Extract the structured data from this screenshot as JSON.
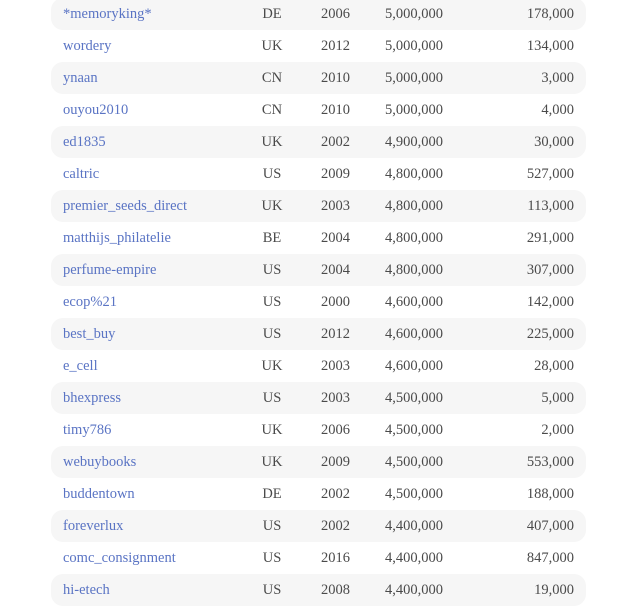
{
  "rows": [
    {
      "seller": "*memoryking*",
      "country": "DE",
      "year": "2006",
      "listings": "5,000,000",
      "feedback": "178,000"
    },
    {
      "seller": "wordery",
      "country": "UK",
      "year": "2012",
      "listings": "5,000,000",
      "feedback": "134,000"
    },
    {
      "seller": "ynaan",
      "country": "CN",
      "year": "2010",
      "listings": "5,000,000",
      "feedback": "3,000"
    },
    {
      "seller": "ouyou2010",
      "country": "CN",
      "year": "2010",
      "listings": "5,000,000",
      "feedback": "4,000"
    },
    {
      "seller": "ed1835",
      "country": "UK",
      "year": "2002",
      "listings": "4,900,000",
      "feedback": "30,000"
    },
    {
      "seller": "caltric",
      "country": "US",
      "year": "2009",
      "listings": "4,800,000",
      "feedback": "527,000"
    },
    {
      "seller": "premier_seeds_direct",
      "country": "UK",
      "year": "2003",
      "listings": "4,800,000",
      "feedback": "113,000"
    },
    {
      "seller": "matthijs_philatelie",
      "country": "BE",
      "year": "2004",
      "listings": "4,800,000",
      "feedback": "291,000"
    },
    {
      "seller": "perfume-empire",
      "country": "US",
      "year": "2004",
      "listings": "4,800,000",
      "feedback": "307,000"
    },
    {
      "seller": "ecop%21",
      "country": "US",
      "year": "2000",
      "listings": "4,600,000",
      "feedback": "142,000"
    },
    {
      "seller": "best_buy",
      "country": "US",
      "year": "2012",
      "listings": "4,600,000",
      "feedback": "225,000"
    },
    {
      "seller": "e_cell",
      "country": "UK",
      "year": "2003",
      "listings": "4,600,000",
      "feedback": "28,000"
    },
    {
      "seller": "bhexpress",
      "country": "US",
      "year": "2003",
      "listings": "4,500,000",
      "feedback": "5,000"
    },
    {
      "seller": "timy786",
      "country": "UK",
      "year": "2006",
      "listings": "4,500,000",
      "feedback": "2,000"
    },
    {
      "seller": "webuybooks",
      "country": "UK",
      "year": "2009",
      "listings": "4,500,000",
      "feedback": "553,000"
    },
    {
      "seller": "buddentown",
      "country": "DE",
      "year": "2002",
      "listings": "4,500,000",
      "feedback": "188,000"
    },
    {
      "seller": "foreverlux",
      "country": "US",
      "year": "2002",
      "listings": "4,400,000",
      "feedback": "407,000"
    },
    {
      "seller": "comc_consignment",
      "country": "US",
      "year": "2016",
      "listings": "4,400,000",
      "feedback": "847,000"
    },
    {
      "seller": "hi-etech",
      "country": "US",
      "year": "2008",
      "listings": "4,400,000",
      "feedback": "19,000"
    }
  ]
}
